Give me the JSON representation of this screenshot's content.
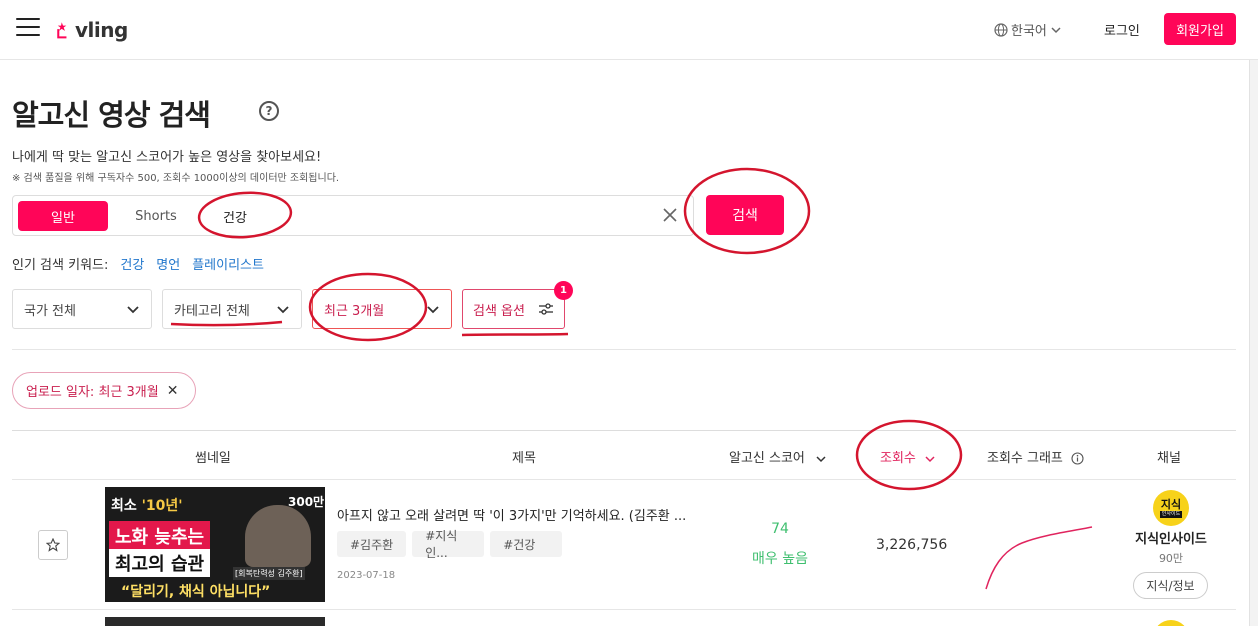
{
  "header": {
    "logo_text": "vling",
    "language": "한국어",
    "login": "로그인",
    "signup": "회원가입"
  },
  "page": {
    "title": "알고신 영상 검색",
    "help": "?",
    "subtitle": "나에게 딱 맞는 알고신 스코어가 높은 영상을 찾아보세요!",
    "note": "※ 검색 품질을 위해 구독자수 500, 조회수 1000이상의 데이터만 조회됩니다."
  },
  "search": {
    "tab_general": "일반",
    "tab_shorts": "Shorts",
    "query": "건강",
    "button": "검색"
  },
  "popular": {
    "label": "인기 검색 키워드:",
    "keywords": [
      "건강",
      "명언",
      "플레이리스트"
    ]
  },
  "filters": {
    "country": "국가 전체",
    "category": "카테고리 전체",
    "period": "최근 3개월",
    "options": "검색 옵션",
    "options_badge": "1"
  },
  "active_filter": {
    "label": "업로드 일자: 최근 3개월"
  },
  "table": {
    "headers": {
      "thumbnail": "썸네일",
      "title": "제목",
      "score": "알고신 스코어",
      "views": "조회수",
      "views_graph": "조회수 그래프",
      "channel": "채널"
    },
    "rows": [
      {
        "title": "아프지 않고 오래 살려면 딱 '이 3가지'만 기억하세요. (김주환 ...",
        "tags": [
          "#김주환",
          "#지식인...",
          "#건강"
        ],
        "date": "2023-07-18",
        "score": "74",
        "score_label": "매우 높음",
        "views": "3,226,756",
        "channel": {
          "logo_top": "지식",
          "logo_bottom": "인사이드",
          "name": "지식인사이드",
          "subscribers": "90만",
          "category": "지식/정보"
        },
        "thumbnail": {
          "line1_pre": "최소",
          "line1_em": "'10년'",
          "line2": "노화 늦추는",
          "line3": "최고의 습관",
          "line4": "“달리기, 채식 아닙니다”",
          "badge": "300만",
          "caption": "[회복탄력성 김주환]"
        }
      }
    ]
  },
  "colors": {
    "brand": "#ff0558",
    "score_green": "#3fbf6f",
    "link_blue": "#2277cc",
    "annotation_red": "#d4152e"
  }
}
